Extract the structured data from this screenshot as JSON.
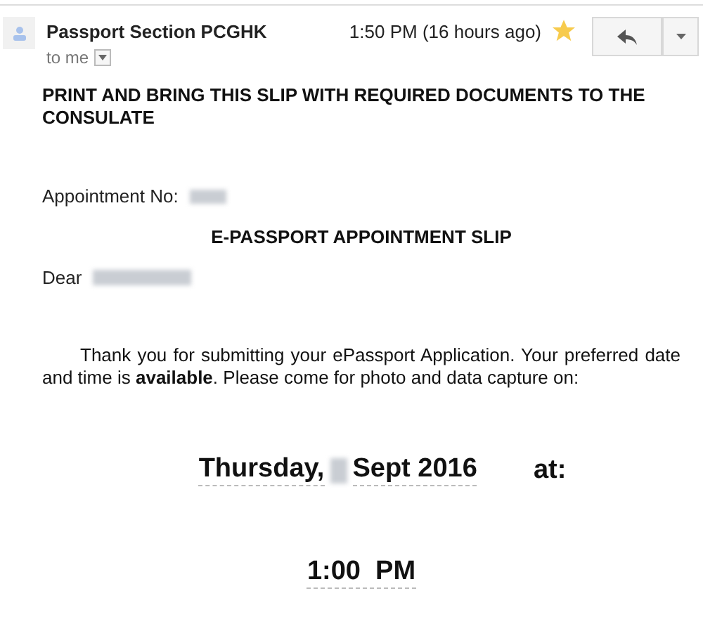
{
  "message": {
    "sender": "Passport Section PCGHK",
    "time": "1:50 PM (16 hours ago)",
    "starred": true,
    "recipient": "to me"
  },
  "body": {
    "heading": "PRINT AND BRING THIS SLIP WITH REQUIRED DOCUMENTS TO THE CONSULATE",
    "appointment_label": "Appointment No:",
    "title": "E-PASSPORT APPOINTMENT SLIP",
    "greeting": "Dear",
    "paragraph": "Thank you for submitting your ePassport Application. Your preferred date and time is **available**. Please come for photo and data capture on:",
    "date_prefix": "Thursday,",
    "date_suffix": "Sept 2016",
    "at": "at:",
    "time": "1:00  PM"
  }
}
